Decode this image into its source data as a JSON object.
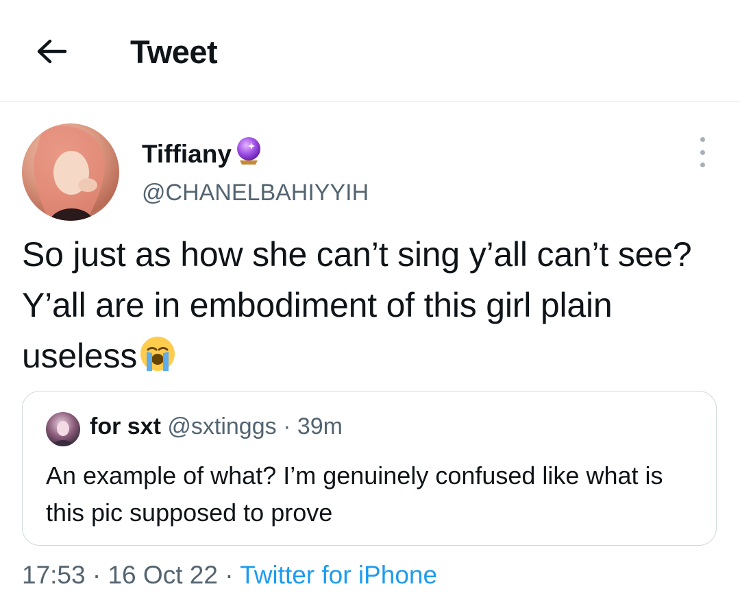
{
  "header": {
    "title": "Tweet",
    "back_icon": "arrow-left-icon"
  },
  "tweet": {
    "author_name": "Tiffiany",
    "author_badge_icon": "crystal-ball-icon",
    "author_handle": "@CHANELBAHIYYIH",
    "text": "So just as how she can’t sing y’all can’t see? Y’all are in embodiment of this girl plain useless",
    "text_emoji_icon": "loudly-crying-face-icon",
    "more_icon": "more-vertical-icon"
  },
  "quote": {
    "author_name": "for sxt",
    "author_handle": "@sxtinggs",
    "separator": " · ",
    "time": "39m",
    "text": "An example of what? I’m genuinely confused like what is this pic supposed to prove"
  },
  "meta": {
    "time": "17:53",
    "sep1": " · ",
    "date": "16 Oct 22",
    "sep2": " · ",
    "source": "Twitter for iPhone"
  },
  "colors": {
    "text": "#0f1419",
    "secondary": "#536471",
    "link": "#1d9bf0",
    "border": "#cfd9de"
  }
}
